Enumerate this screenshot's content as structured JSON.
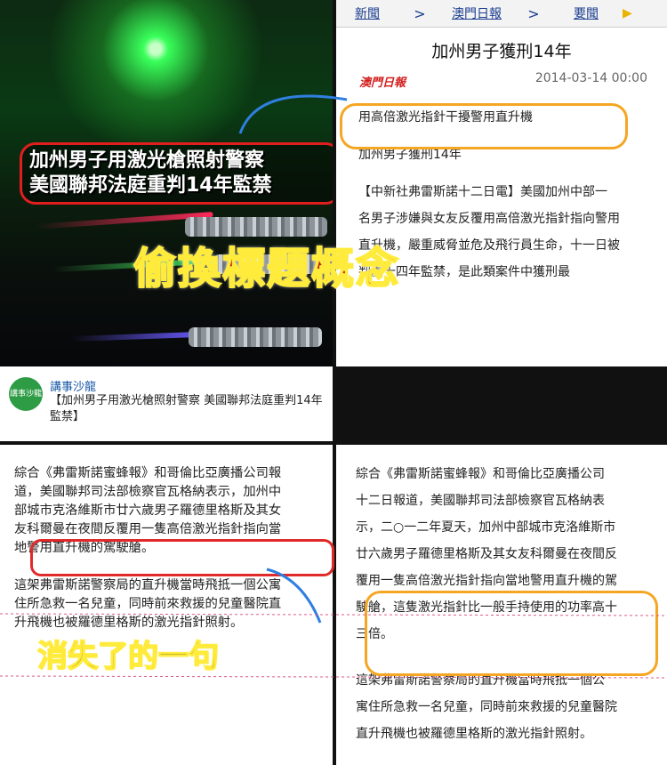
{
  "photo": {
    "caption_line1": "加州男子用激光槍照射警察",
    "caption_line2": "美國聯邦法庭重判14年監禁"
  },
  "news": {
    "nav": [
      "新聞",
      "澳門日報",
      "要聞"
    ],
    "title": "加州男子獲刑14年",
    "logo": "澳門日報",
    "date": "2014-03-14 00:00",
    "headline1": "用高倍激光指針干擾警用直升機",
    "headline2": "加州男子獲刑14年",
    "body_l1": "【中新社弗雷斯諾十二日電】美國加州中部一",
    "body_l2": "名男子涉嫌與女友反覆用高倍激光指針指向警用",
    "body_l3": "直升機，嚴重威脅並危及飛行員生命，十一日被",
    "body_l4": "判處十四年監禁，是此類案件中獲刑最"
  },
  "overlay_title": "偷換標題概念",
  "card": {
    "logo": "講事沙龍",
    "name": "講事沙龍",
    "text": "【加州男子用激光槍照射警察 美國聯邦法庭重判14年監禁】"
  },
  "left_article": {
    "l1": "綜合《弗雷斯諾蜜蜂報》和哥倫比亞廣播公司報",
    "l2": "道，美國聯邦司法部檢察官瓦格納表示，加州中",
    "l3": "部城市克洛維斯市廿六歲男子羅德里格斯及其女",
    "l4": "友科爾曼在夜間反覆用一隻高倍激光指針指向當",
    "l5": "地警用直升機的駕駛艙。",
    "l6": "這架弗雷斯諾警察局的直升機當時飛抵一個公寓",
    "l7": "住所急救一名兒童，同時前來救援的兒童醫院直",
    "l8": "升飛機也被羅德里格斯的激光指針照射。"
  },
  "overlay_missing": "消失了的一句",
  "right_article": {
    "l1": "綜合《弗雷斯諾蜜蜂報》和哥倫比亞廣播公司",
    "l2": "十二日報道，美國聯邦司法部檢察官瓦格納表",
    "l3": "示，二○一二年夏天，加州中部城市克洛維斯市",
    "l4": "廿六歲男子羅德里格斯及其女友科爾曼在夜間反",
    "l5": "覆用一隻高倍激光指針指向當地警用直升機的駕",
    "l6": "駛艙，這隻激光指針比一般手持使用的功率高十",
    "l7": "三倍。",
    "l8": "這架弗雷斯諾警察局的直升機當時飛抵一個公",
    "l9": "寓住所急救一名兒童，同時前來救援的兒童醫院",
    "l10": "直升飛機也被羅德里格斯的激光指針照射。"
  },
  "colors": {
    "red_annotation": "#e02a2a",
    "orange_annotation": "#f5a623",
    "blue_arrow": "#2f7fe0"
  }
}
